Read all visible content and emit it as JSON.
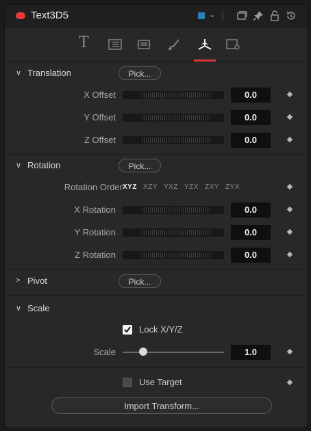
{
  "header": {
    "title": "Text3D5",
    "swatch_color": "#2f7fb8",
    "icons": [
      "chevron-down-icon",
      "window-icon",
      "pin-icon",
      "lock-icon",
      "reset-icon"
    ]
  },
  "tabs": {
    "items": [
      "text-tab-icon",
      "layout-tab-icon",
      "transform-tab-icon",
      "shading-tab-icon",
      "3d-transform-tab-icon",
      "settings-tab-icon"
    ],
    "active": "3d-transform-tab-icon",
    "text_glyph": "T"
  },
  "translation": {
    "title": "Translation",
    "pick_label": "Pick...",
    "rows": [
      {
        "label": "X Offset",
        "value": "0.0"
      },
      {
        "label": "Y Offset",
        "value": "0.0"
      },
      {
        "label": "Z Offset",
        "value": "0.0"
      }
    ]
  },
  "rotation": {
    "title": "Rotation",
    "pick_label": "Pick...",
    "order_label": "Rotation Order",
    "order_options": [
      "XYZ",
      "XZY",
      "YXZ",
      "YZX",
      "ZXY",
      "ZYX"
    ],
    "order_selected": "XYZ",
    "rows": [
      {
        "label": "X Rotation",
        "value": "0.0"
      },
      {
        "label": "Y Rotation",
        "value": "0.0"
      },
      {
        "label": "Z Rotation",
        "value": "0.0"
      }
    ]
  },
  "pivot": {
    "title": "Pivot",
    "pick_label": "Pick..."
  },
  "scale": {
    "title": "Scale",
    "lock_label": "Lock X/Y/Z",
    "lock_checked": true,
    "label": "Scale",
    "value": "1.0"
  },
  "target": {
    "use_target_label": "Use Target",
    "use_target_checked": false,
    "import_label": "Import Transform..."
  },
  "colors": {
    "accent_red": "#d93838",
    "node_red": "#e33b3b"
  }
}
